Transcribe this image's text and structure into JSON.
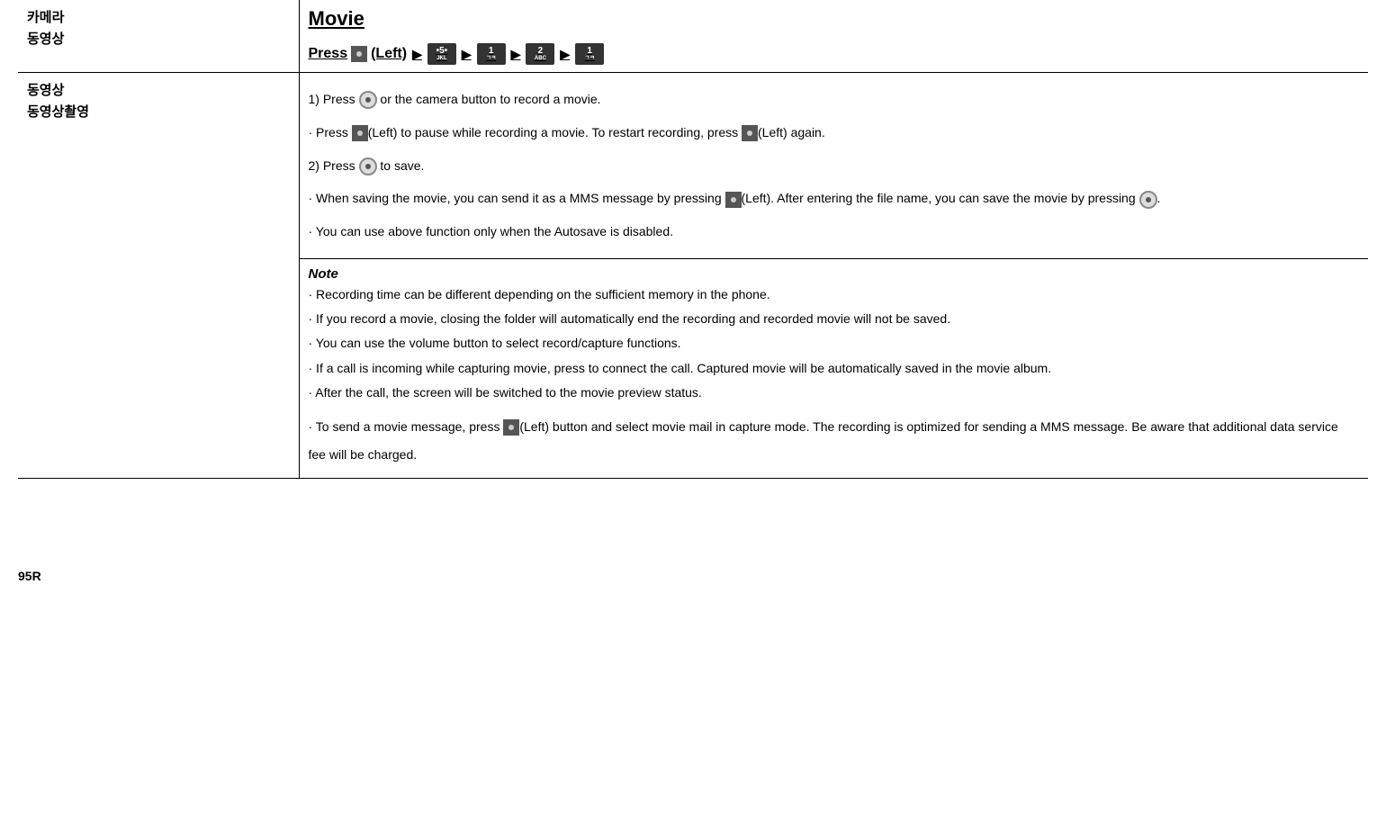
{
  "sidebar": {
    "row1_line1": "카메라",
    "row1_line2": "동영상",
    "row2_line1": "동영상",
    "row2_line2": "동영상촬영"
  },
  "header": {
    "title": "Movie",
    "press": "Press",
    "left": "(Left)",
    "arrow": "▶",
    "key1_top": "•5•",
    "key1_bot": "JKL",
    "key2_top": "1",
    "key2_bot": "ㄱㅋ",
    "key3_top": "2",
    "key3_bot": "ABC",
    "key4_top": "1",
    "key4_bot": "ㄱㅋ"
  },
  "instructions": {
    "step1_a": "1) Press ",
    "step1_b": " or the camera button to record a movie.",
    "pause_a": "· Press ",
    "pause_b": "(Left) to pause while recording a movie. To restart recording, press ",
    "pause_c": "(Left) again.",
    "step2_a": "2) Press ",
    "step2_b": " to save.",
    "mms_a": "· When saving the movie, you can send it as a MMS message by pressing ",
    "mms_b": "(Left). After entering the file name, you can save the movie by pressing ",
    "mms_c": ".",
    "autosave": "· You can use above function only when the Autosave is disabled."
  },
  "note": {
    "title": "Note",
    "n1": "· Recording time can be different depending on the sufficient memory in the phone.",
    "n2": "· If you record a movie, closing the folder will automatically end the recording and recorded movie will not be saved.",
    "n3": "· You can use the volume button to select record/capture functions.",
    "n4": "· If a call is incoming while capturing movie, press to connect the call. Captured movie will be automatically saved in the movie album.",
    "n5": "· After the call, the screen will be switched to the movie preview status.",
    "n6_a": "· To send a movie message, press ",
    "n6_b": "(Left) button and select movie mail in capture mode. The recording is optimized for sending a MMS message. Be aware that additional data service fee will be charged."
  },
  "page_number": "95R"
}
